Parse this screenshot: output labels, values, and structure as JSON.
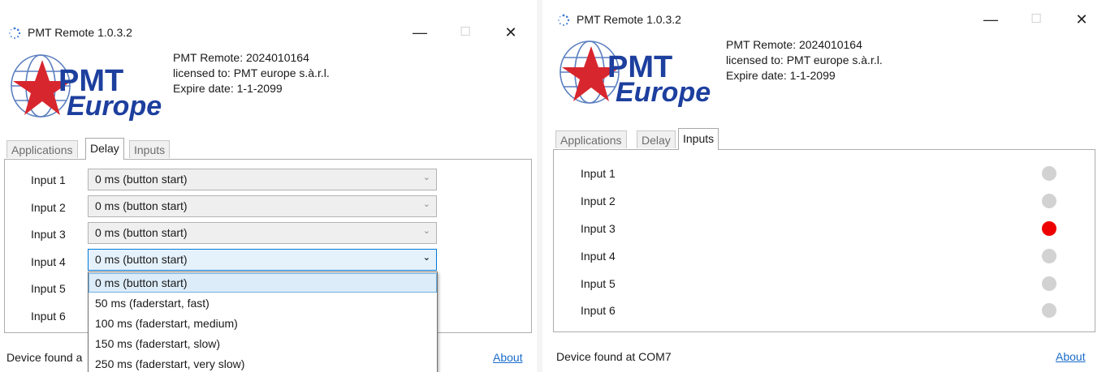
{
  "left_window": {
    "title": "PMT Remote 1.0.3.2",
    "license": {
      "line1": "PMT Remote: 2024010164",
      "line2": "licensed to: PMT europe s.à.r.l.",
      "line3": "Expire date: 1-1-2099"
    },
    "logo": {
      "top": "PMT",
      "bottom": "Europe"
    },
    "tabs": [
      "Applications",
      "Delay",
      "Inputs"
    ],
    "active_tab": "Delay",
    "delay_rows": [
      {
        "label": "Input 1",
        "value": "0 ms (button start)"
      },
      {
        "label": "Input 2",
        "value": "0 ms (button start)"
      },
      {
        "label": "Input 3",
        "value": "0 ms (button start)"
      },
      {
        "label": "Input 4",
        "value": "0 ms (button start)"
      },
      {
        "label": "Input 5",
        "value": ""
      },
      {
        "label": "Input 6",
        "value": ""
      }
    ],
    "dropdown_options": [
      "0 ms (button start)",
      "50 ms (faderstart, fast)",
      "100 ms (faderstart, medium)",
      "150 ms (faderstart, slow)",
      "250 ms (faderstart, very slow)"
    ],
    "selected_option": "0 ms (button start)",
    "footer_status": "Device found a",
    "about_link": "About"
  },
  "right_window": {
    "title": "PMT Remote 1.0.3.2",
    "license": {
      "line1": "PMT Remote: 2024010164",
      "line2": "licensed to: PMT europe s.à.r.l.",
      "line3": "Expire date: 1-1-2099"
    },
    "logo": {
      "top": "PMT",
      "bottom": "Europe"
    },
    "tabs": [
      "Applications",
      "Delay",
      "Inputs"
    ],
    "active_tab": "Inputs",
    "inputs": [
      {
        "label": "Input 1",
        "active": false
      },
      {
        "label": "Input 2",
        "active": false
      },
      {
        "label": "Input 3",
        "active": true
      },
      {
        "label": "Input 4",
        "active": false
      },
      {
        "label": "Input 5",
        "active": false
      },
      {
        "label": "Input 6",
        "active": false
      }
    ],
    "footer_status": "Device found at COM7",
    "about_link": "About"
  },
  "caption_buttons": {
    "minimize": "—",
    "maximize": "☐",
    "close": "✕"
  },
  "icons": [
    "app-loading-icon",
    "minimize-icon",
    "maximize-icon",
    "close-icon",
    "chevron-down-icon",
    "status-led-icon"
  ],
  "colors": {
    "logo_blue": "#1d3f9e",
    "logo_red": "#d8262e",
    "led_on": "#ee0000",
    "led_off": "#d2d2d2",
    "link": "#1a6cc9"
  }
}
